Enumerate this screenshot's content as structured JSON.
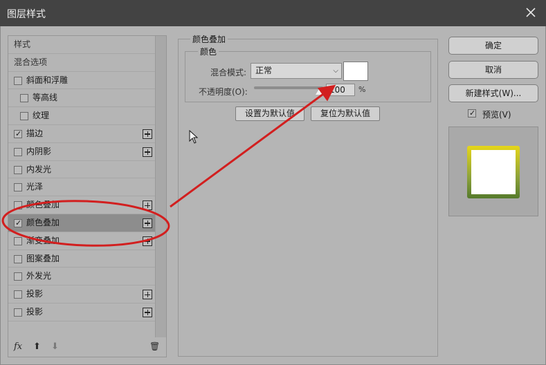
{
  "window": {
    "title": "图层样式"
  },
  "styles_list": {
    "items": [
      {
        "label": "样式",
        "checkbox": false,
        "checked": false,
        "plus": false
      },
      {
        "label": "混合选项",
        "checkbox": false,
        "checked": false,
        "plus": false
      },
      {
        "label": "斜面和浮雕",
        "checkbox": true,
        "checked": false,
        "plus": false
      },
      {
        "label": "等高线",
        "checkbox": true,
        "checked": false,
        "plus": false
      },
      {
        "label": "纹理",
        "checkbox": true,
        "checked": false,
        "plus": false
      },
      {
        "label": "描边",
        "checkbox": true,
        "checked": true,
        "plus": true
      },
      {
        "label": "内阴影",
        "checkbox": true,
        "checked": false,
        "plus": true
      },
      {
        "label": "内发光",
        "checkbox": true,
        "checked": false,
        "plus": false
      },
      {
        "label": "光泽",
        "checkbox": true,
        "checked": false,
        "plus": false
      },
      {
        "label": "颜色叠加",
        "checkbox": true,
        "checked": false,
        "plus": true
      },
      {
        "label": "颜色叠加",
        "checkbox": true,
        "checked": true,
        "plus": true,
        "selected": true
      },
      {
        "label": "渐变叠加",
        "checkbox": true,
        "checked": false,
        "plus": true
      },
      {
        "label": "图案叠加",
        "checkbox": true,
        "checked": false,
        "plus": false
      },
      {
        "label": "外发光",
        "checkbox": true,
        "checked": false,
        "plus": false
      },
      {
        "label": "投影",
        "checkbox": true,
        "checked": false,
        "plus": true
      },
      {
        "label": "投影",
        "checkbox": true,
        "checked": false,
        "plus": true
      }
    ],
    "toolbar": {
      "fx": "fx",
      "up": "⬆",
      "down": "⬇",
      "trash": "🗑"
    }
  },
  "color_overlay": {
    "group_title": "颜色叠加",
    "sub_title": "颜色",
    "blend_mode_label": "混合模式:",
    "blend_mode_value": "正常",
    "swatch_color": "#ffffff",
    "opacity_label": "不透明度(O):",
    "opacity_value": "100",
    "opacity_unit": "%",
    "set_default_button": "设置为默认值",
    "reset_default_button": "复位为默认值"
  },
  "actions": {
    "ok": "确定",
    "cancel": "取消",
    "new_style": "新建样式(W)...",
    "preview_label": "预览(V)",
    "preview_checked": true
  },
  "annotation": {
    "color": "#d21f1f"
  }
}
